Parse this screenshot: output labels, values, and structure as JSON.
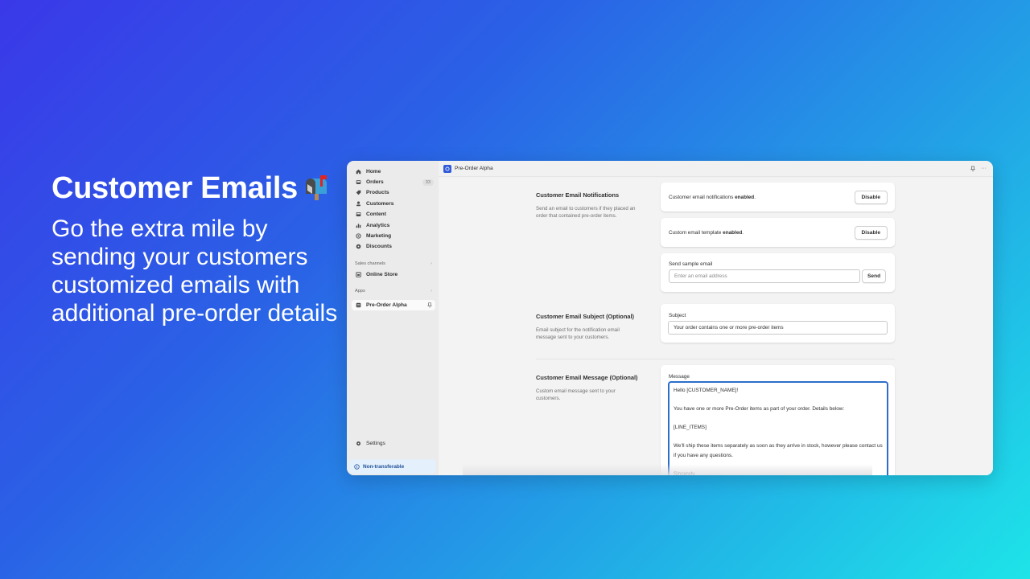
{
  "hero": {
    "title": "Customer Emails",
    "emoji_icon": "open-mailbox-with-raised-flag",
    "description": "Go the extra mile by sending your customers customized emails with additional pre-order details"
  },
  "sidebar": {
    "items": [
      {
        "label": "Home",
        "icon": "home-icon"
      },
      {
        "label": "Orders",
        "icon": "inbox-icon",
        "badge": "33"
      },
      {
        "label": "Products",
        "icon": "tag-icon"
      },
      {
        "label": "Customers",
        "icon": "person-icon"
      },
      {
        "label": "Content",
        "icon": "image-icon"
      },
      {
        "label": "Analytics",
        "icon": "bar-chart-icon"
      },
      {
        "label": "Marketing",
        "icon": "target-icon"
      },
      {
        "label": "Discounts",
        "icon": "discount-icon"
      }
    ],
    "sales_channels_label": "Sales channels",
    "online_store_label": "Online Store",
    "apps_label": "Apps",
    "app_item_label": "Pre-Order Alpha",
    "settings_label": "Settings",
    "nontransferable_label": "Non-transferable"
  },
  "topbar": {
    "app_title": "Pre-Order Alpha"
  },
  "sections": {
    "notifications": {
      "title": "Customer Email Notifications",
      "description": "Send an email to customers if they placed an order that contained pre-order items.",
      "status_prefix": "Customer email notifications",
      "status_value": "enabled",
      "disable_label": "Disable",
      "template_prefix": "Custom email template",
      "template_value": "enabled",
      "template_disable_label": "Disable",
      "sample_label": "Send sample email",
      "sample_placeholder": "Enter an email address",
      "send_label": "Send"
    },
    "subject": {
      "title": "Customer Email Subject (Optional)",
      "description": "Email subject for the notification email message sent to your customers.",
      "field_label": "Subject",
      "value": "Your order contains one or more pre-order items"
    },
    "message": {
      "title": "Customer Email Message (Optional)",
      "description": "Custom email message sent to your customers.",
      "field_label": "Message",
      "value": "Hello [CUSTOMER_NAME]!\n\nYou have one or more Pre-Order items as part of your order. Details below:\n\n[LINE_ITEMS]\n\nWe'll ship these items separately as soon as they arrive in stock, however please contact us if you have any questions.\n\nSincerely,"
    }
  },
  "colors": {
    "accent": "#2c6ecb",
    "gradient_start": "#3a38e8",
    "gradient_end": "#1ee4e8"
  }
}
